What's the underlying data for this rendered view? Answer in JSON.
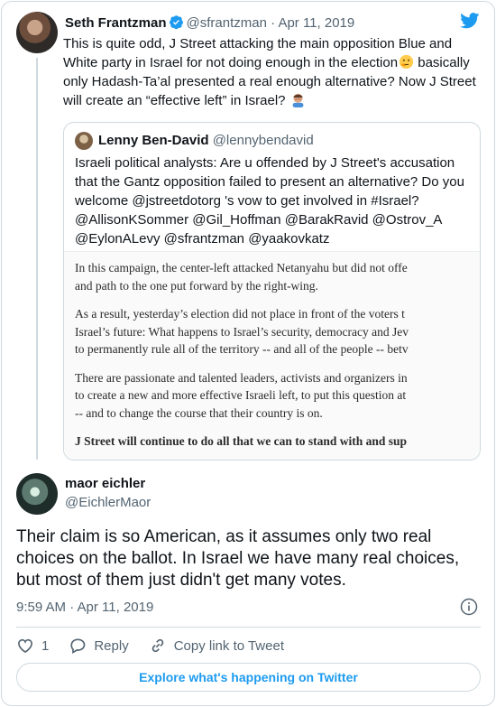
{
  "parent": {
    "name": "Seth Frantzman",
    "handle": "@sfrantzman",
    "date": "· Apr 11, 2019",
    "text1": "This is quite odd, J Street attacking the main opposition Blue and White party in Israel for not doing enough in the election",
    "text2": " basically only Hadash-Ta’al presented a real enough alternative? Now J Street will create an “effective left” in Israel? ",
    "emoji1": "thinking-face-icon",
    "emoji2": "man-facepalming-icon"
  },
  "quote": {
    "name": "Lenny Ben-David",
    "handle": "@lennybendavid",
    "text": "Israeli political analysts: Are u offended by J Street's accusation that the Gantz opposition failed to present an alternative? Do you welcome @jstreetdotorg 's vow to get involved in #Israel? @AllisonKSommer @Gil_Hoffman @BarakRavid @Ostrov_A @EylonALevy @sfrantzman @yaakovkatz",
    "image_lines": [
      [
        "In this campaign, the center-left attacked Netanyahu but did not offe",
        "and path to the one put forward by the right-wing."
      ],
      [
        "As a result, yesterday’s election did not place in front of the voters t",
        "Israel’s future: What happens to Israel’s security, democracy and Jev",
        "to permanently rule all of the territory -- and all of the people -- betv"
      ],
      [
        "There are passionate and talented leaders, activists and organizers in",
        "to create a new and more effective Israeli left, to put this question at",
        "-- and to change the course that their country is on."
      ],
      [
        "J Street will continue to do all that we can to stand with and sup"
      ]
    ]
  },
  "reply": {
    "name": "maor eichler",
    "handle": "@EichlerMaor",
    "text": "Their claim is so American, as it assumes only two real choices on the ballot. In Israel we have many real choices, but most of them just didn't get many votes.",
    "time": "9:59 AM · Apr 11, 2019"
  },
  "actions": {
    "like_count": "1",
    "reply_label": "Reply",
    "copy_label": "Copy link to Tweet"
  },
  "explore_label": "Explore what's happening on Twitter",
  "colors": {
    "accent": "#1d9bf0",
    "muted": "#536471",
    "border": "#cfd9de"
  }
}
